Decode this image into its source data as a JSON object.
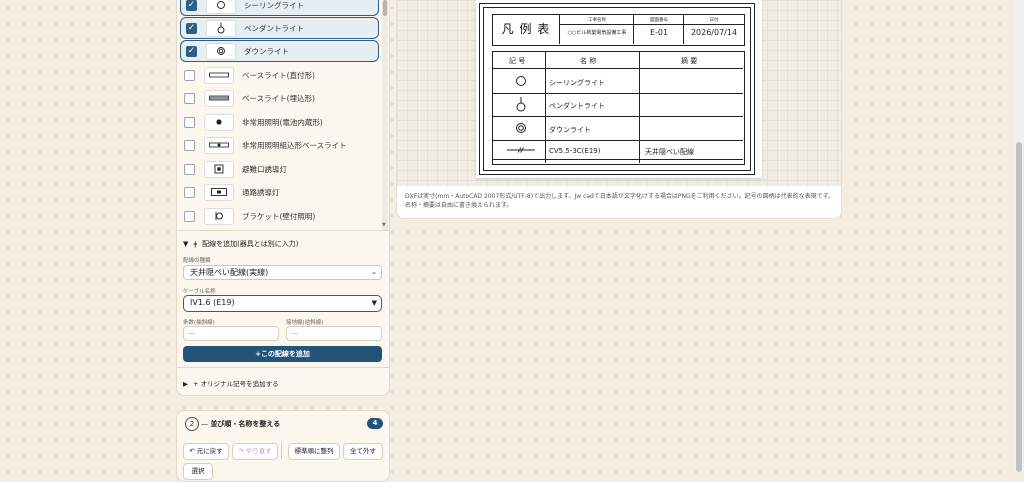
{
  "symbols": [
    {
      "label": "シーリングライト",
      "checked": true
    },
    {
      "label": "ペンダントライト",
      "checked": true
    },
    {
      "label": "ダウンライト",
      "checked": true
    },
    {
      "label": "ベースライト(直付形)",
      "checked": false
    },
    {
      "label": "ベースライト(埋込形)",
      "checked": false
    },
    {
      "label": "非常用照明(電池内蔵形)",
      "checked": false
    },
    {
      "label": "非常用照明組込形ベースライト",
      "checked": false
    },
    {
      "label": "避難口誘導灯",
      "checked": false
    },
    {
      "label": "通路誘導灯",
      "checked": false
    },
    {
      "label": "ブラケット(壁付照明)",
      "checked": false
    }
  ],
  "wiring": {
    "heading": "配線を追加(器具とは別に入力)",
    "type_label": "配線の種類",
    "type_value": "天井隠ぺい配線(実線)",
    "cable_label": "ケーブル名称",
    "cable_value": "IV1.6 (E19)",
    "count_label": "条数(抽斜線)",
    "conn_label": "接地線(逆斜線)",
    "count_placeholder": "—",
    "conn_placeholder": "—",
    "add_button": "+この配線を追加"
  },
  "original_symbol_label": "+ オリジナル記号を追加する",
  "order_section": {
    "step": "2",
    "title": "並び順・名称を整える",
    "count": "4",
    "buttons": [
      "元に戻す",
      "やり直す",
      "標準順に整列",
      "全て外す",
      "選択"
    ]
  },
  "sheet": {
    "title": "凡 例 表",
    "project_head": "工事名称",
    "project_value": "○○ビル新築電気設備工事",
    "drawing_head": "図面番号",
    "drawing_value": "E-01",
    "date_head": "日付",
    "date_value": "2026/07/14",
    "col_symbol": "記 号",
    "col_name": "名 称",
    "col_desc": "摘 要",
    "rows": [
      {
        "name": "シーリングライト",
        "desc": ""
      },
      {
        "name": "ペンダントライト",
        "desc": ""
      },
      {
        "name": "ダウンライト",
        "desc": ""
      },
      {
        "name": "CV5.5-3C(E19)",
        "desc": "天井隠ぺい配線"
      }
    ]
  },
  "note": "DXFは実寸(mm・AutoCAD 2007形式/UTF-8)で出力します。Jw cadで日本語が文字化けする場合はPNGをご利用ください。記号の図柄は代表的な表現です。名称・摘要は自由に書き換えられます。"
}
